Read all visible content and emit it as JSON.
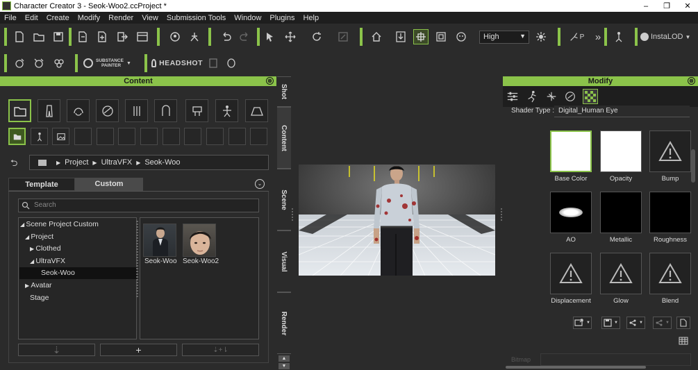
{
  "window": {
    "title": "Character Creator 3 - Seok-Woo2.ccProject *",
    "controls": [
      "–",
      "❐",
      "✕"
    ]
  },
  "menu": [
    "File",
    "Edit",
    "Create",
    "Modify",
    "Render",
    "View",
    "Submission Tools",
    "Window",
    "Plugins",
    "Help"
  ],
  "toolbar": {
    "quality_value": "High",
    "substance_label": "SUBSTANCE\nPAINTER",
    "substance_top": "SUBSTANCE",
    "substance_bottom": "PAINTER",
    "headshot_label": "HEADSHOT",
    "instalod_label": "InstaLOD",
    "p_label": "P",
    "more": "»"
  },
  "content_panel": {
    "title": "Content",
    "close": "⊗",
    "categories": [
      "folder-icon",
      "clothing-icon",
      "hair-icon",
      "materials-icon",
      "accessories-icon",
      "body-icon",
      "props-icon",
      "pose-icon",
      "stage-icon"
    ],
    "breadcrumb": [
      "Project",
      "UltraVFX",
      "Seok-Woo"
    ],
    "tabs": {
      "template": "Template",
      "custom": "Custom"
    },
    "search_placeholder": "Search",
    "tree": [
      {
        "label": "Scene Project Custom",
        "expanded": true,
        "depth": 0
      },
      {
        "label": "Project",
        "expanded": true,
        "depth": 1
      },
      {
        "label": "Clothed",
        "expanded": false,
        "depth": 2
      },
      {
        "label": "UltraVFX",
        "expanded": true,
        "depth": 2
      },
      {
        "label": "Seok-Woo",
        "selected": true,
        "depth": 3
      },
      {
        "label": "Avatar",
        "expanded": false,
        "depth": 1
      },
      {
        "label": "Stage",
        "depth": 1
      }
    ],
    "items": [
      {
        "label": "Seok-Woo"
      },
      {
        "label": "Seok-Woo2"
      }
    ],
    "bottom_buttons": [
      "⇣",
      "+",
      "⇣+⇂"
    ]
  },
  "side_tabs": [
    "Shot",
    "Content",
    "Scene",
    "Visual",
    "Render"
  ],
  "modify_panel": {
    "title": "Modify",
    "close": "⊗",
    "shader_type_label": "Shader Type :",
    "shader_type_value": "Digital_Human Eye",
    "channels": [
      {
        "label": "Base Color",
        "state": "white"
      },
      {
        "label": "Opacity",
        "state": "white"
      },
      {
        "label": "Bump",
        "state": "warning"
      },
      {
        "label": "AO",
        "state": "blur"
      },
      {
        "label": "Metallic",
        "state": "black"
      },
      {
        "label": "Roughness",
        "state": "black"
      },
      {
        "label": "Displacement",
        "state": "warning"
      },
      {
        "label": "Glow",
        "state": "warning"
      },
      {
        "label": "Blend",
        "state": "warning"
      }
    ],
    "bitmap_label": "Bitmap"
  },
  "colors": {
    "accent": "#8bc34a",
    "bg": "#2b2b2b",
    "dark": "#1e1e1e"
  }
}
